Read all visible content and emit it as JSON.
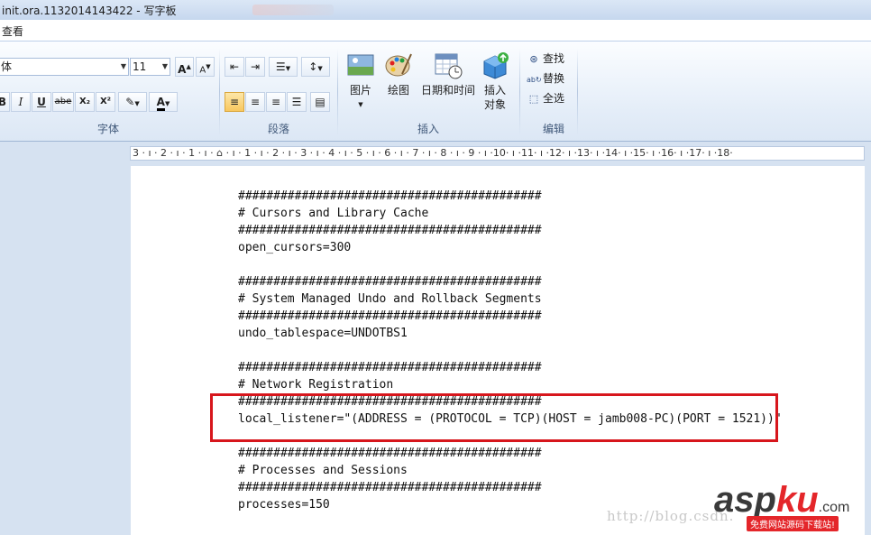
{
  "window": {
    "title": "init.ora.1132014143422 - 写字板"
  },
  "menubar": {
    "items": [
      "查看"
    ]
  },
  "ribbon": {
    "font": {
      "family": "体",
      "size": "11",
      "grow_label": "A",
      "shrink_label": "A",
      "bold": "B",
      "italic": "I",
      "underline": "U",
      "strike": "abe",
      "subscript": "X₂",
      "superscript": "X²",
      "font_color_label": "A",
      "group_label": "字体"
    },
    "paragraph": {
      "group_label": "段落"
    },
    "insert": {
      "picture_label": "图片",
      "draw_label": "绘图",
      "datetime_label": "日期和时间",
      "object_label_1": "插入",
      "object_label_2": "对象",
      "group_label": "插入"
    },
    "edit": {
      "find_label": "查找",
      "replace_label": "替换",
      "selectall_label": "全选",
      "group_label": "编辑"
    }
  },
  "ruler": {
    "text": "3 · ı · 2 · ı · 1 · ı · ⌂ · ı · 1 · ı · 2 · ı · 3 · ı · 4 · ı · 5 · ı · 6 · ı · 7 · ı · 8 · ı · 9 · ı ·10· ı ·11· ı ·12· ı ·13· ı ·14· ı ·15· ı ·16· ı ·17· ı ·18·"
  },
  "document": {
    "lines": [
      "###########################################",
      "# Cursors and Library Cache",
      "###########################################",
      "open_cursors=300",
      "",
      "###########################################",
      "# System Managed Undo and Rollback Segments",
      "###########################################",
      "undo_tablespace=UNDOTBS1",
      "",
      "###########################################",
      "# Network Registration",
      "###########################################",
      "local_listener=\"(ADDRESS = (PROTOCOL = TCP)(HOST = jamb008-PC)(PORT = 1521))\"",
      "",
      "###########################################",
      "# Processes and Sessions",
      "###########################################",
      "processes=150"
    ]
  },
  "watermark": {
    "url": "http://blog.csdn.",
    "logo_asp": "asp",
    "logo_ku": "ku",
    "logo_com": ".com",
    "sub": "免费网站源码下载站!"
  },
  "colors": {
    "highlight": "#d7161c",
    "ribbon_bg": "#e4edf8"
  }
}
